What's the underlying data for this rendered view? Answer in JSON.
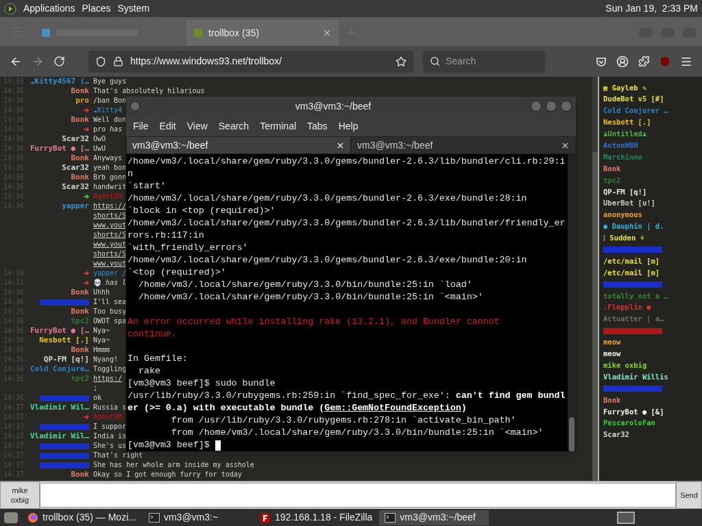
{
  "top_panel": {
    "menus": [
      "Applications",
      "Places",
      "System"
    ],
    "clock": "Sun Jan 19,  2:33 PM"
  },
  "browser": {
    "tabs": [
      {
        "selected": false
      },
      {
        "title": "trollbox (35)",
        "selected": true
      }
    ],
    "forward": {
      "disabled": true
    },
    "address": "https://www.windows93.net/trollbox/",
    "search": {
      "placeholder": "Search"
    }
  },
  "chat": {
    "rows": [
      {
        "time": "14:36",
        "nick": "☁Kitty4567 (…",
        "color": "#3a8fd0",
        "message": "Bye guys",
        "kind": "text"
      },
      {
        "time": "14:36",
        "nick": "Bonk",
        "color": "#e07a6a",
        "message": "That's absolutely hilarious",
        "kind": "text"
      },
      {
        "time": "14:36",
        "nick": "pro",
        "color": "#d9a521",
        "message": "/ban Bon",
        "kind": "text"
      },
      {
        "time": "14:36",
        "event": true,
        "color": "#d93030",
        "message": "☁Kitty4",
        "kind": "mention"
      },
      {
        "time": "14:36",
        "nick": "Bonk",
        "color": "#e07a6a",
        "message": "Well don",
        "kind": "text"
      },
      {
        "time": "14:36",
        "event": true,
        "color": "#d93030",
        "message": "pro *has*",
        "kind": "text"
      },
      {
        "time": "14:36",
        "nick": "Scar32",
        "color": "#d8d8d8",
        "message": "OwO",
        "kind": "text"
      },
      {
        "time": "14:36",
        "nick": "FurryBot ● […",
        "color": "#e07a9a",
        "message": "UwU",
        "kind": "text"
      },
      {
        "time": "14:36",
        "nick": "Bonk",
        "color": "#e07a6a",
        "message": "Anyways",
        "kind": "text"
      },
      {
        "time": "14:36",
        "nick": "Scar32",
        "color": "#d8d8d8",
        "message": "yeah bon",
        "kind": "text"
      },
      {
        "time": "14:36",
        "nick": "Bonk",
        "color": "#e07a6a",
        "message": "Brb gonn",
        "kind": "text"
      },
      {
        "time": "14:36",
        "nick": "Scar32",
        "color": "#d8d8d8",
        "message": "handwrit",
        "kind": "text"
      },
      {
        "time": "14:36",
        "event": true,
        "color": "#3cc03c",
        "message": "AgentXM",
        "kind": "alert"
      },
      {
        "time": "14:36",
        "nick": "yapper",
        "color": "#3a8fd0",
        "message": "https://",
        "kind": "link"
      },
      {
        "message": "shorts/S",
        "kind": "link"
      },
      {
        "message": "www.yout",
        "kind": "link"
      },
      {
        "message": "shorts/S",
        "kind": "link"
      },
      {
        "message": "www.yout",
        "kind": "link"
      },
      {
        "message": "shorts/S",
        "kind": "link"
      },
      {
        "message": "www.yout",
        "kind": "link"
      },
      {
        "time": "14:36",
        "event": true,
        "color": "#d93030",
        "message": "yapper /",
        "kind": "mention"
      },
      {
        "time": "14:31",
        "event": true,
        "color": "#d93030",
        "message": "💀 *has l*",
        "kind": "text"
      },
      {
        "time": "14:36",
        "nick": "Bonk",
        "color": "#e07a6a",
        "message": "Uhhh",
        "kind": "text"
      },
      {
        "time": "14:36",
        "redacted": true,
        "color": "#1a2ecc",
        "message": "I'll sea",
        "kind": "text"
      },
      {
        "time": "14:36",
        "nick": "Bonk",
        "color": "#e07a6a",
        "message": "Too busy",
        "kind": "text"
      },
      {
        "time": "14:36",
        "nick": "tpc2",
        "color": "#2e7d32",
        "message": "OWOT spa",
        "kind": "text"
      },
      {
        "time": "14:36",
        "nick": "FurryBot ● […",
        "color": "#e07a9a",
        "message": "Nya~",
        "kind": "text"
      },
      {
        "time": "14:36",
        "nick": "Nesbott [.]",
        "color": "#e8c020",
        "message": "Nya~",
        "kind": "text"
      },
      {
        "time": "14:36",
        "nick": "Bonk",
        "color": "#e07a6a",
        "message": "Hmmm",
        "kind": "text"
      },
      {
        "time": "14:36",
        "nick": "QP-FM [q!]",
        "color": "#d8d8d8",
        "message": "Nyang!",
        "kind": "text"
      },
      {
        "time": "14:36",
        "nick": "Cold Conjure…",
        "color": "#2b82c9",
        "message": "Toggling",
        "kind": "text"
      },
      {
        "time": "14:36",
        "nick": "tpc2",
        "color": "#2e7d32",
        "message": "https:/",
        "kind": "link"
      },
      {
        "message": ";",
        "kind": "text"
      },
      {
        "time": "14:36",
        "redacted": true,
        "color": "#1a2ecc",
        "message": "ok",
        "kind": "text"
      },
      {
        "time": "14:37",
        "nick": "Vladimir Wil…",
        "color": "#4fd6a0",
        "message": "Russia s",
        "kind": "text"
      },
      {
        "time": "14:32",
        "event": true,
        "color": "#d93030",
        "message": "AgentXM",
        "kind": "alert"
      },
      {
        "time": "14:37",
        "redacted": true,
        "color": "#1a2ecc",
        "message": "I suppor",
        "kind": "text"
      },
      {
        "time": "14:37",
        "nick": "Vladimir Wil…",
        "color": "#4fd6a0",
        "message": "India is",
        "kind": "text"
      },
      {
        "time": "14:37",
        "redacted": true,
        "color": "#1a2ecc",
        "message": "She's us",
        "kind": "text"
      },
      {
        "time": "14:37",
        "redacted": true,
        "color": "#1a2ecc",
        "message": "That's right",
        "kind": "text"
      },
      {
        "time": "14:37",
        "redacted": true,
        "color": "#1a2ecc",
        "message": "She has her whole arm inside my asshole",
        "kind": "text"
      },
      {
        "time": "14:37",
        "nick": "Bonk",
        "color": "#e07a6a",
        "message": "Okay so I got enough furry for today",
        "kind": "text"
      }
    ]
  },
  "users": [
    {
      "name": "▦ Gayleb ✎",
      "color": "#e8e040"
    },
    {
      "name": "DudeBot v5 [#]",
      "color": "#e8e040"
    },
    {
      "name": "Cold Conjurer …",
      "color": "#2b82c9"
    },
    {
      "name": "Nesbott [.]",
      "color": "#e8c020"
    },
    {
      "name": "♟Untitled♟",
      "color": "#4caf50"
    },
    {
      "name": "AntonHBH",
      "color": "#2e6ed0"
    },
    {
      "name": "Marchinno",
      "color": "#1f8a6a"
    },
    {
      "name": "Bonk",
      "color": "#e07a6a"
    },
    {
      "name": "tpc2",
      "color": "#2e7d32"
    },
    {
      "name": "QP-FM [q!]",
      "color": "#e8e8e8"
    },
    {
      "name": "UberBot [u!]",
      "color": "#c8c8c8"
    },
    {
      "name": "anonymous",
      "color": "#f0a020"
    },
    {
      "name": "● Dauphin | d.",
      "color": "#3ab0d8"
    },
    {
      "name": "⁝ Sudden ⚘",
      "color": "#e8e040"
    },
    {
      "redacted": true,
      "color": "#1a2ecc"
    },
    {
      "name": "/etc/mail [m]",
      "color": "#e8e040"
    },
    {
      "name": "/etc/mail [m]",
      "color": "#e8e040"
    },
    {
      "redacted": true,
      "color": "#1a2ecc"
    },
    {
      "name": "totally not a …",
      "color": "#2e8b2e"
    },
    {
      "name": ".Flepplin ●",
      "color": "#d83030"
    },
    {
      "name": "Actuatter | a…",
      "color": "#6e6e62"
    },
    {
      "redacted": true,
      "color": "#b01818"
    },
    {
      "name": "meow",
      "color": "#f0a020"
    },
    {
      "name": "meow",
      "color": "#f0f0f0"
    },
    {
      "name": "mike oxbig",
      "color": "#8bd020"
    },
    {
      "name": "Vladimir Willis",
      "color": "#80e8c8"
    },
    {
      "redacted": true,
      "color": "#1a2ecc"
    },
    {
      "name": "Bonk",
      "color": "#e07a6a"
    },
    {
      "name": "FurryBot ● [&]",
      "color": "#f0f0f0"
    },
    {
      "name": "PescaroloFan",
      "color": "#30d030"
    },
    {
      "name": "Scar32",
      "color": "#d8d8d8"
    }
  ],
  "composer": {
    "nick_button": "mike oxbig",
    "send": "Send"
  },
  "terminal": {
    "title": "vm3@vm3:~/beef",
    "menus": [
      "File",
      "Edit",
      "View",
      "Search",
      "Terminal",
      "Tabs",
      "Help"
    ],
    "tabs": [
      {
        "title": "vm3@vm3:~/beef",
        "selected": true
      },
      {
        "title": "vm3@vm3:~/beef",
        "selected": false
      }
    ],
    "lines": [
      {
        "kind": "output",
        "segments": [
          {
            "text": "/home/vm3/.local/share/gem/ruby/3.3.0/gems/bundler-2.6.3/lib/bundler/cli.rb:29:i",
            "kind": "plain"
          }
        ]
      },
      {
        "kind": "output",
        "segments": [
          {
            "text": "n",
            "kind": "plain"
          }
        ]
      },
      {
        "kind": "output",
        "segments": [
          {
            "text": "`start'",
            "kind": "plain"
          }
        ]
      },
      {
        "kind": "output",
        "segments": [
          {
            "text": "/home/vm3/.local/share/gem/ruby/3.3.0/gems/bundler-2.6.3/exe/bundle:28:in",
            "kind": "plain"
          }
        ]
      },
      {
        "kind": "output",
        "segments": [
          {
            "text": "`block in <top (required)>'",
            "kind": "plain"
          }
        ]
      },
      {
        "kind": "output",
        "segments": [
          {
            "text": "/home/vm3/.local/share/gem/ruby/3.3.0/gems/bundler-2.6.3/lib/bundler/friendly_er",
            "kind": "plain"
          }
        ]
      },
      {
        "kind": "output",
        "segments": [
          {
            "text": "rors.rb:117:in",
            "kind": "plain"
          }
        ]
      },
      {
        "kind": "output",
        "segments": [
          {
            "text": "`with_friendly_errors'",
            "kind": "plain"
          }
        ]
      },
      {
        "kind": "output",
        "segments": [
          {
            "text": "/home/vm3/.local/share/gem/ruby/3.3.0/gems/bundler-2.6.3/exe/bundle:20:in",
            "kind": "plain"
          }
        ]
      },
      {
        "kind": "output",
        "segments": [
          {
            "text": "`<top (required)>'",
            "kind": "plain"
          }
        ]
      },
      {
        "kind": "output",
        "segments": [
          {
            "text": "  /home/vm3/.local/share/gem/ruby/3.3.0/bin/bundle:25:in `load'",
            "kind": "plain"
          }
        ]
      },
      {
        "kind": "output",
        "segments": [
          {
            "text": "  /home/vm3/.local/share/gem/ruby/3.3.0/bin/bundle:25:in `<main>'",
            "kind": "plain"
          }
        ]
      },
      {
        "kind": "blank"
      },
      {
        "kind": "output",
        "segments": [
          {
            "text": "An error occurred while installing rake (13.2.1), and Bundler cannot",
            "kind": "error"
          }
        ]
      },
      {
        "kind": "output",
        "segments": [
          {
            "text": "continue.",
            "kind": "error"
          }
        ]
      },
      {
        "kind": "blank"
      },
      {
        "kind": "output",
        "segments": [
          {
            "text": "In Gemfile:",
            "kind": "plain"
          }
        ]
      },
      {
        "kind": "output",
        "segments": [
          {
            "text": "  rake",
            "kind": "plain"
          }
        ]
      },
      {
        "kind": "output",
        "segments": [
          {
            "text": "[vm3@vm3 beef]$ sudo bundle",
            "kind": "plain"
          }
        ]
      },
      {
        "kind": "output",
        "segments": [
          {
            "text": "/usr/lib/ruby/3.3.0/rubygems.rb:259:in `find_spec_for_exe': ",
            "kind": "plain"
          },
          {
            "text": "can't find gem bundl",
            "kind": "bold"
          }
        ]
      },
      {
        "kind": "output",
        "segments": [
          {
            "text": "er (>= 0.a) with executable bundle (",
            "kind": "bold"
          },
          {
            "text": "Gem::GemNotFoundException",
            "kind": "bold-underline"
          },
          {
            "text": ")",
            "kind": "bold"
          }
        ]
      },
      {
        "kind": "output",
        "segments": [
          {
            "text": "        from /usr/lib/ruby/3.3.0/rubygems.rb:278:in `activate_bin_path'",
            "kind": "plain"
          }
        ]
      },
      {
        "kind": "output",
        "segments": [
          {
            "text": "        from /home/vm3/.local/share/gem/ruby/3.3.0/bin/bundle:25:in `<main>'",
            "kind": "plain"
          }
        ]
      },
      {
        "kind": "prompt",
        "segments": [
          {
            "text": "[vm3@vm3 beef]$ ",
            "kind": "plain"
          }
        ]
      }
    ]
  },
  "taskbar": {
    "items": [
      {
        "kind": "firefox",
        "label": "trollbox (35) — Mozi...",
        "selected": false
      },
      {
        "kind": "terminal",
        "label": "vm3@vm3:~",
        "selected": false
      },
      {
        "kind": "filezilla",
        "label": "192.168.1.18 - FileZilla",
        "selected": false
      },
      {
        "kind": "terminal",
        "label": "vm3@vm3:~/beef",
        "selected": true
      }
    ]
  }
}
